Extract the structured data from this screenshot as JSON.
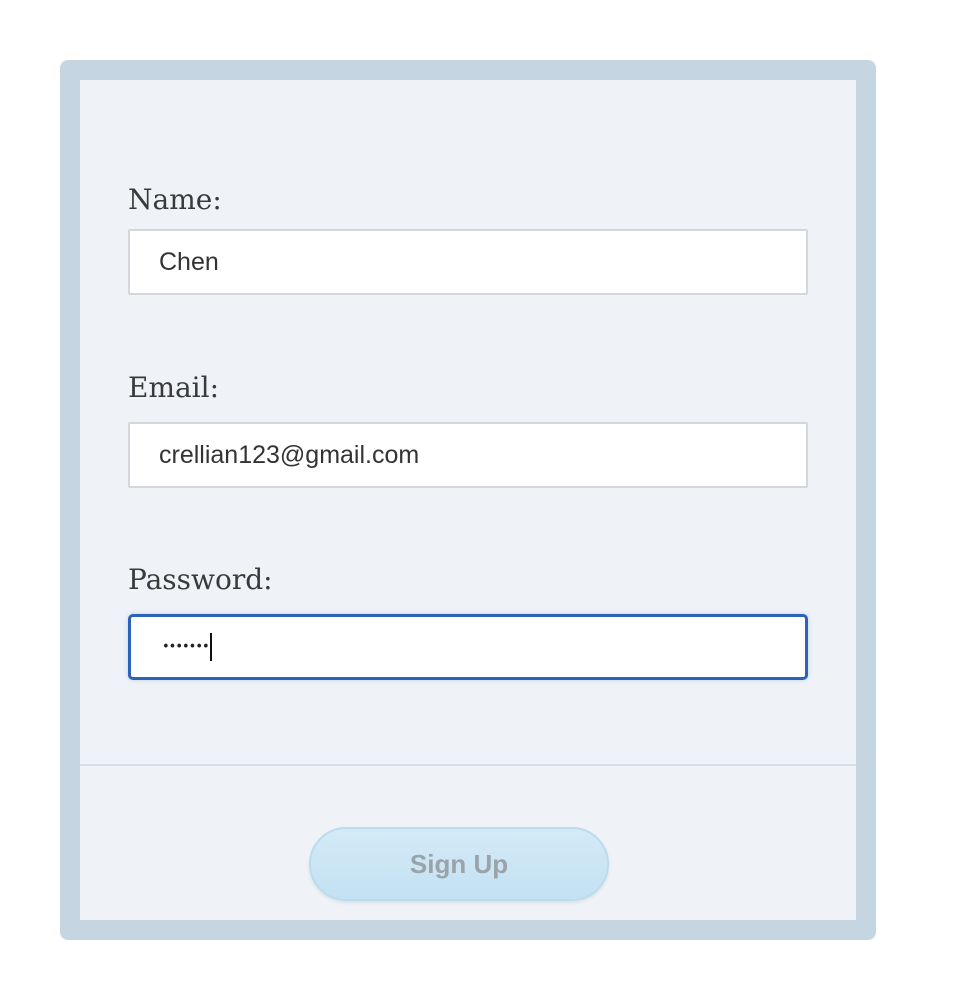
{
  "form": {
    "name_label": "Name:",
    "name_value": "Chen",
    "email_label": "Email:",
    "email_value": "crellian123@gmail.com",
    "password_label": "Password:",
    "password_masked": "•••••••",
    "submit_label": "Sign Up"
  },
  "colors": {
    "frame": "#c5d6e2",
    "card": "#eff3f7",
    "focus_border": "#2b63b8",
    "button": "#c9e4f4"
  }
}
